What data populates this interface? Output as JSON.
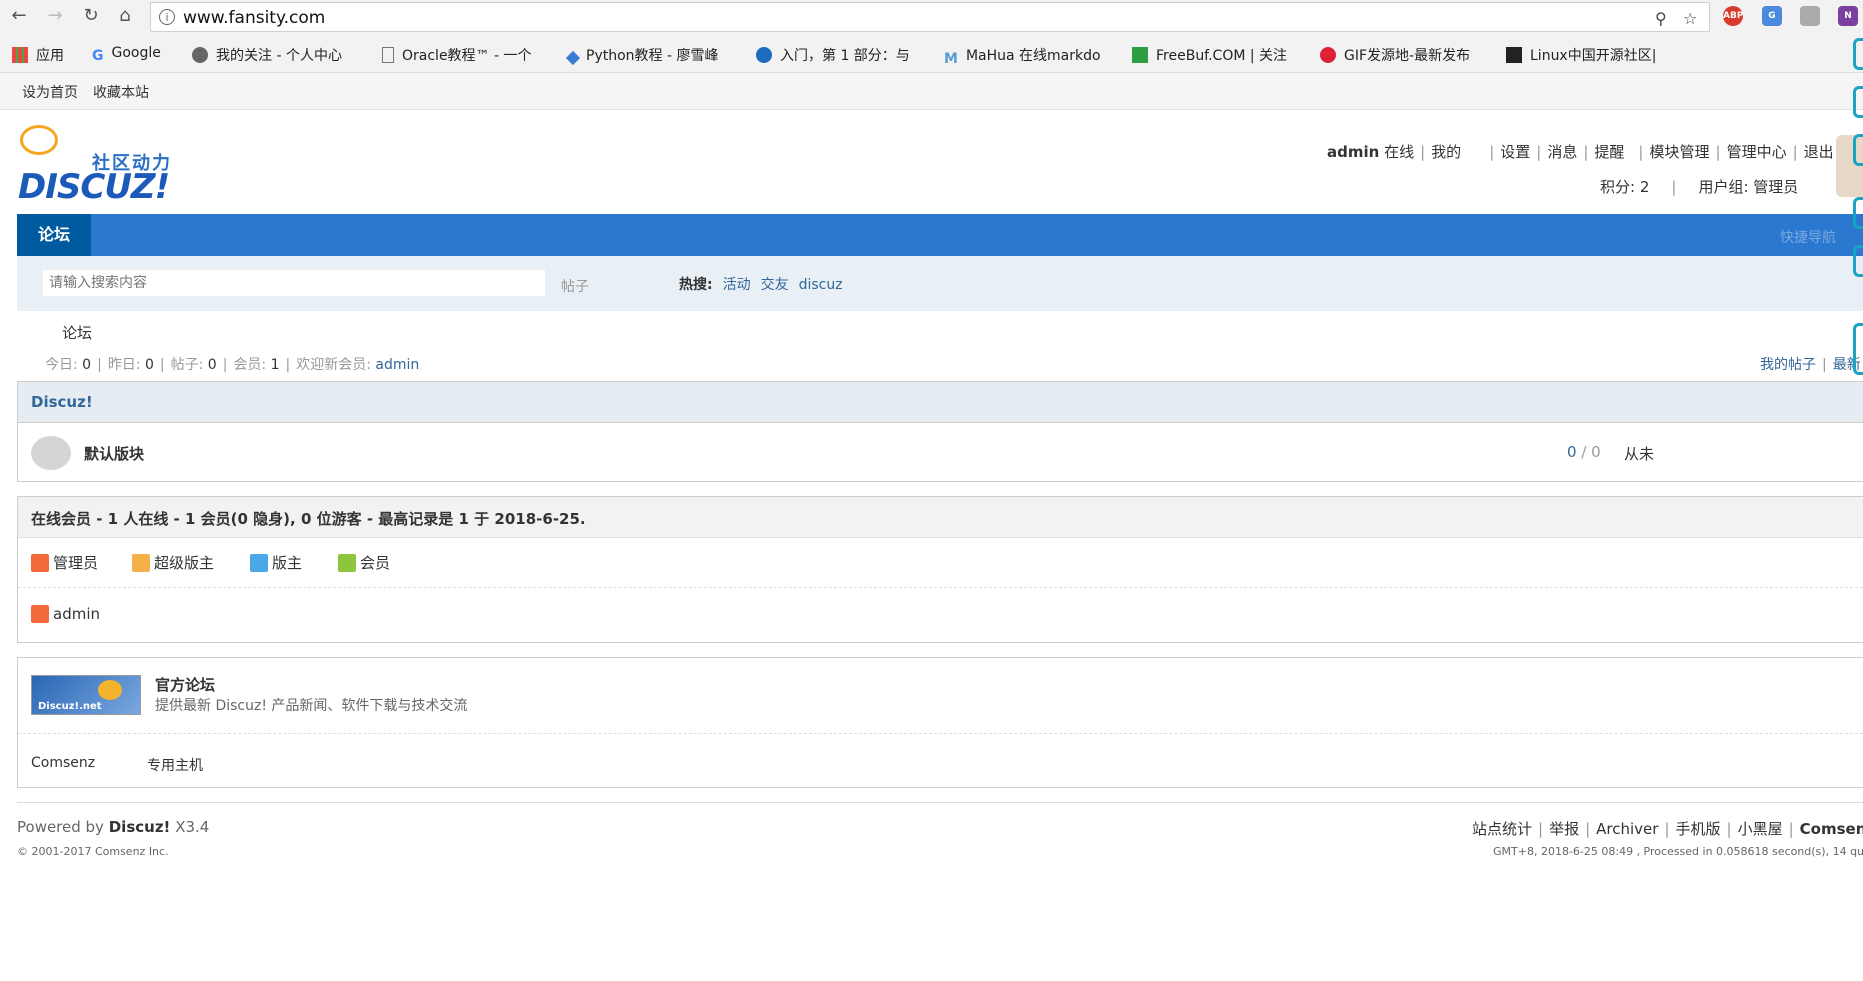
{
  "browser": {
    "url": "www.fansity.com",
    "apps_label": "应用",
    "bookmarks": [
      {
        "label": "Google"
      },
      {
        "label": "我的关注 - 个人中心"
      },
      {
        "label": "Oracle教程™ - 一个"
      },
      {
        "label": "Python教程 - 廖雪峰"
      },
      {
        "label": "入门，第 1 部分：与"
      },
      {
        "label": "MaHua 在线markdo"
      },
      {
        "label": "FreeBuf.COM | 关注"
      },
      {
        "label": "GIF发源地-最新发布"
      },
      {
        "label": "Linux中国开源社区|"
      }
    ],
    "ext_abp": "ABP"
  },
  "topbar": {
    "set_home": "设为首页",
    "bookmark": "收藏本站"
  },
  "logo": {
    "slogan": "社区动力",
    "brand": "DISCUZ!"
  },
  "user": {
    "name": "admin",
    "status": "在线",
    "links": [
      "我的",
      "设置",
      "消息",
      "提醒",
      "模块管理",
      "管理中心",
      "退出"
    ],
    "points": "积分: 2",
    "group": "用户组: 管理员"
  },
  "nav": {
    "tab": "论坛",
    "quick": "快捷导航"
  },
  "search": {
    "placeholder": "请输入搜索内容",
    "type": "帖子",
    "hot_label": "热搜:",
    "hot": [
      "活动",
      "交友",
      "discuz"
    ]
  },
  "breadcrumb": "论坛",
  "stats": {
    "today_label": "今日:",
    "today": "0",
    "yesterday_label": "昨日:",
    "yesterday": "0",
    "posts_label": "帖子:",
    "posts": "0",
    "members_label": "会员:",
    "members": "1",
    "welcome_label": "欢迎新会员:",
    "welcome": "admin",
    "my_posts": "我的帖子",
    "latest": "最新"
  },
  "category": {
    "title": "Discuz!",
    "forum_name": "默认版块",
    "threads": "0",
    "posts": "0",
    "last": "从未"
  },
  "online": {
    "title": "在线会员 - 1 人在线 - 1 会员(0 隐身), 0 位游客 - 最高记录是 1 于 2018-6-25.",
    "legend": [
      "管理员",
      "超级版主",
      "版主",
      "会员"
    ],
    "users": [
      "admin"
    ]
  },
  "links": {
    "official_title": "官方论坛",
    "official_desc": "提供最新 Discuz! 产品新闻、软件下载与技术交流",
    "logo_text": "Discuz!.net",
    "text_links": [
      "Comsenz",
      "专用主机"
    ]
  },
  "footer": {
    "powered_prefix": "Powered by",
    "powered_brand": "Discuz!",
    "version": "X3.4",
    "copyright": "© 2001-2017 Comsenz Inc.",
    "links": [
      "站点统计",
      "举报",
      "Archiver",
      "手机版",
      "小黑屋"
    ],
    "brand": "Comsenz",
    "info": "GMT+8, 2018-6-25 08:49 , Processed in 0.058618 second(s), 14 qu"
  },
  "colors": {
    "nav_blue": "#2b78d0",
    "nav_active": "#005aa0",
    "link": "#336699",
    "header_bg": "#e5edf2"
  },
  "icons": [
    "back-icon",
    "forward-icon",
    "reload-icon",
    "home-icon",
    "info-icon",
    "key-icon",
    "star-icon"
  ]
}
